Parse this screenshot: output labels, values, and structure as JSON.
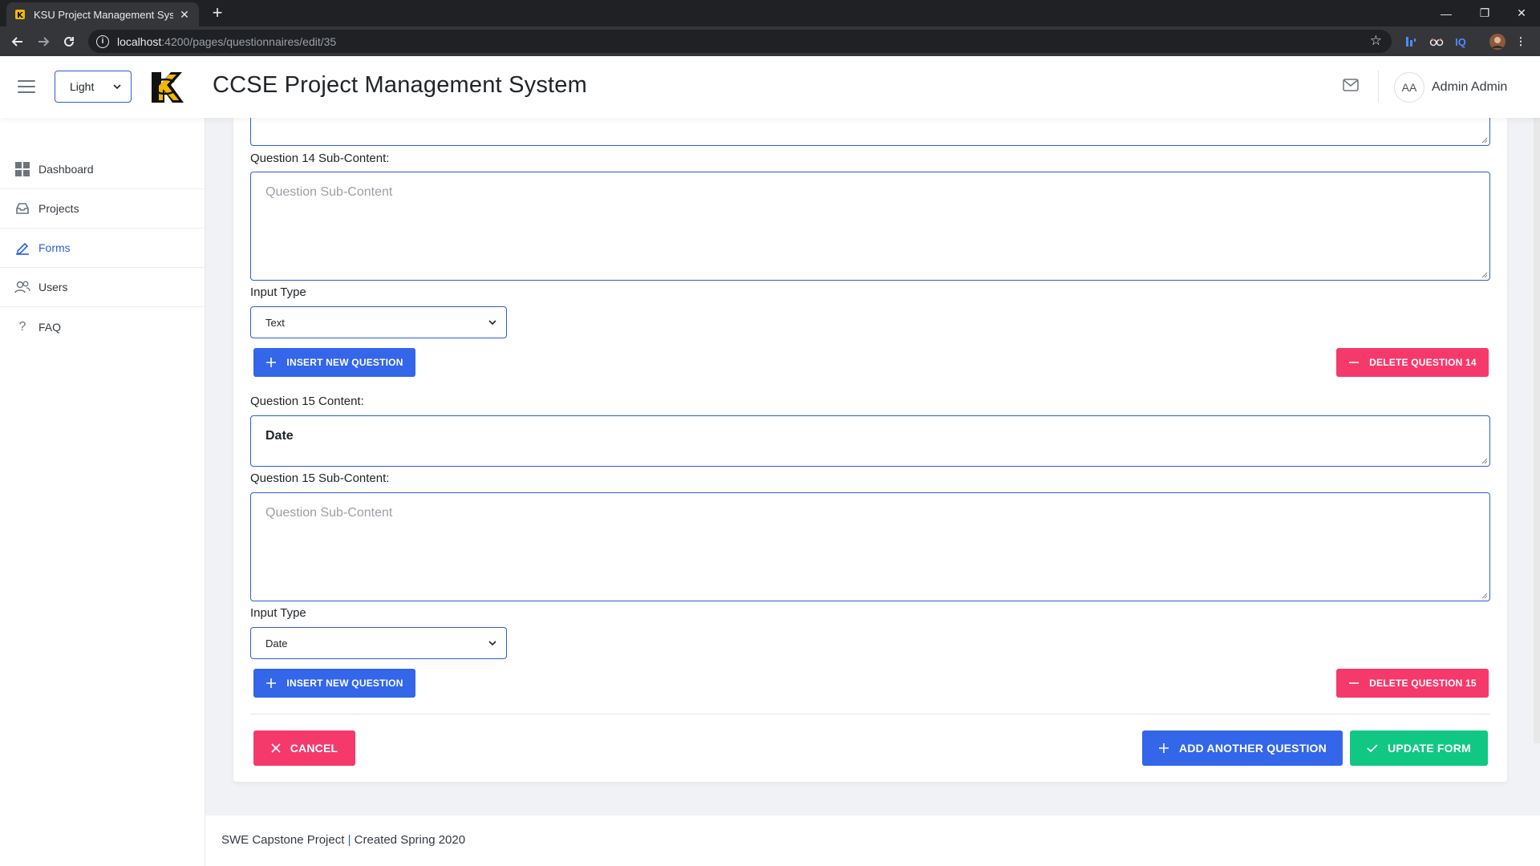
{
  "browser": {
    "tab_title": "KSU Project Management Syster",
    "url_host": "localhost",
    "url_path": ":4200/pages/questionnaires/edit/35",
    "ext_iq": "IQ"
  },
  "header": {
    "theme_value": "Light",
    "title": "CCSE Project Management System",
    "avatar_initials": "AA",
    "user_name": "Admin Admin"
  },
  "sidebar": {
    "items": [
      {
        "label": "Dashboard"
      },
      {
        "label": "Projects"
      },
      {
        "label": "Forms"
      },
      {
        "label": "Users"
      },
      {
        "label": "FAQ"
      }
    ]
  },
  "form": {
    "q14": {
      "sub_label": "Question 14 Sub-Content:",
      "sub_placeholder": "Question Sub-Content",
      "input_type_label": "Input Type",
      "input_type_value": "Text",
      "insert_label": "INSERT NEW QUESTION",
      "delete_label": "DELETE QUESTION 14"
    },
    "q15": {
      "content_label": "Question 15 Content:",
      "content_value": "Date",
      "sub_label": "Question 15 Sub-Content:",
      "sub_placeholder": "Question Sub-Content",
      "input_type_label": "Input Type",
      "input_type_value": "Date",
      "insert_label": "INSERT NEW QUESTION",
      "delete_label": "DELETE QUESTION 15"
    },
    "cancel_label": "CANCEL",
    "add_label": "ADD ANOTHER QUESTION",
    "update_label": "UPDATE FORM"
  },
  "footer": {
    "left": "SWE Capstone Project",
    "sep": "|",
    "right": "Created Spring 2020"
  },
  "colors": {
    "primary": "#3366e8",
    "danger": "#f5396b",
    "success": "#10c883"
  }
}
